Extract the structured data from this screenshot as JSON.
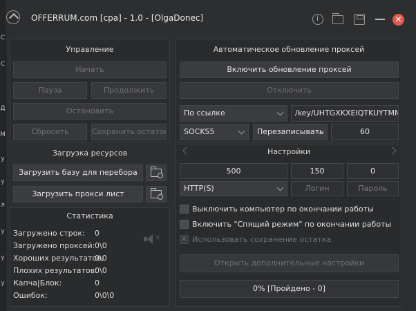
{
  "window": {
    "title": "OFFERRUM.com [cpa] - 1.0 - [OlgaDonec]",
    "close_glyph": "✕"
  },
  "left_strip": [
    "С",
    "С",
    "Д",
    "М",
    "у",
    "у",
    "л",
    "у",
    "у",
    "у"
  ],
  "control": {
    "header": "Управление",
    "start": "Начать",
    "pause": "Пауза",
    "resume": "Продолжить",
    "stop": "Остановить",
    "reset": "Сбросить",
    "save_rest": "Сохранить остаток"
  },
  "resources": {
    "header": "Загрузка ресурсов",
    "load_base": "Загрузить базу для перебора",
    "load_proxy": "Загрузить прокси лист"
  },
  "stats": {
    "header": "Статистика",
    "rows": [
      {
        "label": "Загружено строк:",
        "value": "0"
      },
      {
        "label": "Загружено проксей:",
        "value": "0\\0"
      },
      {
        "label": "Хороших результатов:",
        "value": "0\\0"
      },
      {
        "label": "Плохих результатов:",
        "value": "0\\0"
      },
      {
        "label": "Капча|Блок:",
        "value": "0"
      },
      {
        "label": "Ошибок:",
        "value": "0\\0\\0"
      }
    ]
  },
  "proxy_update": {
    "header": "Автоматическое обновление проксей",
    "enable": "Включить обновление проксей",
    "disable": "Отключить",
    "source_select": "По ссылке",
    "url_value": "/key/UHTGXKXEIQTKUYTMMZIYC",
    "type_select": "SOCKS5",
    "mode_select": "Перезаписывать",
    "interval_value": "60"
  },
  "settings": {
    "header": "Настройки",
    "field1": "500",
    "field2": "150",
    "field3": "0",
    "protocol_select": "HTTP(S)",
    "login_placeholder": "Логин",
    "password_placeholder": "Пароль",
    "opt_shutdown": "Выключить компьютер по окончании работы",
    "opt_sleep": "Включить \"Спящий режим\" по окончании работы",
    "opt_use_rest": "Использовать сохранение остатка",
    "open_more": "Открыть дополнительные настройки",
    "progress_text": "0% [Пройдено - 0]"
  }
}
